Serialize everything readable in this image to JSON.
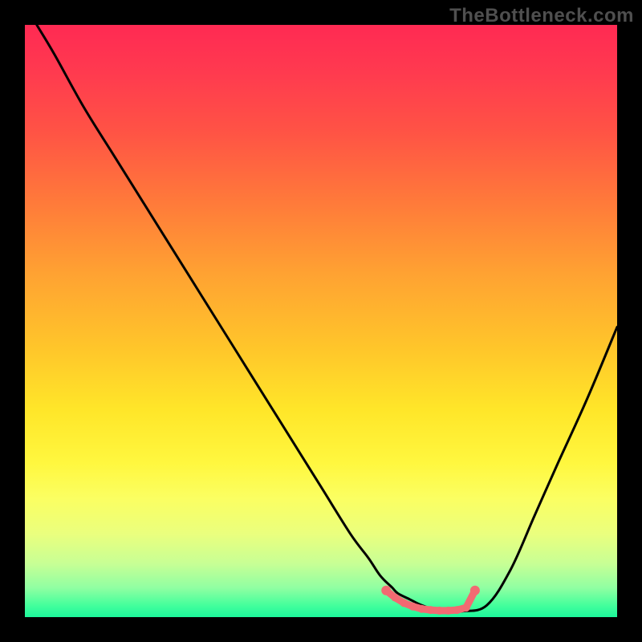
{
  "watermark": "TheBottleneck.com",
  "chart_data": {
    "type": "line",
    "title": "",
    "xlabel": "",
    "ylabel": "",
    "xlim": [
      0,
      100
    ],
    "ylim": [
      0,
      100
    ],
    "background": "red-yellow-green-vertical-gradient",
    "series": [
      {
        "name": "bottleneck-curve",
        "x": [
          2,
          5,
          10,
          15,
          20,
          25,
          30,
          35,
          40,
          45,
          50,
          55,
          58,
          60,
          62,
          63,
          65,
          67,
          70,
          72,
          74,
          78,
          82,
          86,
          90,
          95,
          100
        ],
        "values": [
          100,
          95,
          86,
          78,
          70,
          62,
          54,
          46,
          38,
          30,
          22,
          14,
          10,
          7,
          5,
          4,
          3,
          2,
          1,
          1,
          1,
          2,
          8,
          17,
          26,
          37,
          49
        ],
        "color": "#000000"
      },
      {
        "name": "optimal-zone-markers",
        "x": [
          61,
          62.5,
          64,
          65.5,
          67,
          68.5,
          70,
          71.5,
          73,
          74.5,
          76
        ],
        "values": [
          4.5,
          3.3,
          2.4,
          1.8,
          1.4,
          1.2,
          1.1,
          1.1,
          1.2,
          1.6,
          4.5
        ],
        "color": "#f26a72",
        "style": "dots"
      }
    ],
    "optimal_range_x": [
      61,
      76
    ]
  },
  "colors": {
    "page_bg": "#000000",
    "curve": "#000000",
    "marker": "#f26a72",
    "watermark": "#4f4f4f"
  }
}
